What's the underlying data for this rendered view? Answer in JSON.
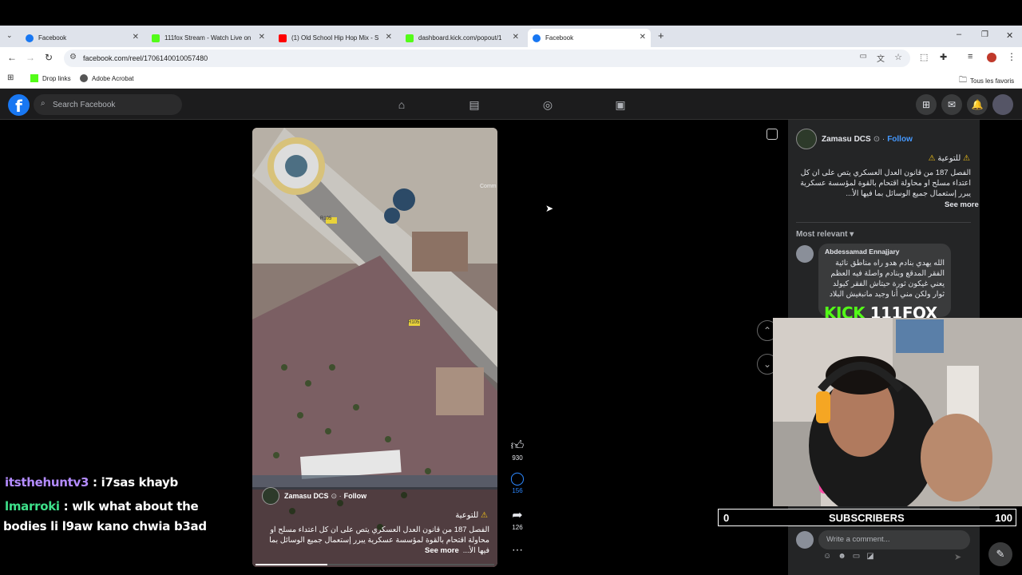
{
  "browser": {
    "tabs": [
      {
        "title": "Facebook",
        "color": "#1877f2",
        "active": false
      },
      {
        "title": "111fox Stream - Watch Live on",
        "color": "#53fc18",
        "active": false
      },
      {
        "title": "(1) Old School Hip Hop Mix - S",
        "color": "#ff0000",
        "active": false
      },
      {
        "title": "dashboard.kick.com/popout/1",
        "color": "#53fc18",
        "active": false
      },
      {
        "title": "Facebook",
        "color": "#1877f2",
        "active": true
      }
    ],
    "url": "facebook.com/reel/1706140010057480",
    "bookmarks": {
      "drop_links": "Drop links",
      "adobe": "Adobe Acrobat",
      "all_favorites": "Tous les favoris"
    }
  },
  "facebook": {
    "search_placeholder": "Search Facebook"
  },
  "reel": {
    "page_name": "Zamasu DCS",
    "follow": "Follow",
    "warning": "للتوعية",
    "caption": "الفصل 187 من قانون العدل العسكري يتص على ان كل اعتداء مسلح او محاولة اقتحام بالقوة لمؤسسة عسكرية يبرر إستعمال جميع الوسائل بما فيها الأ...",
    "see_more": "See more",
    "likes": "930",
    "comments": "156",
    "shares": "126",
    "map_labels": [
      "R105",
      "R105",
      "Comm"
    ],
    "progress": 0.3
  },
  "side_panel": {
    "page_name": "Zamasu DCS",
    "follow": "Follow",
    "warning": "للتوعية",
    "caption": "الفصل 187 من قانون العدل العسكري يتص على ان كل اعتداء مسلح او محاولة اقتحام بالقوة لمؤسسة عسكرية يبرر إستعمال جميع الوسائل بما فيها الأ...",
    "see_more": "See more",
    "sort": "Most relevant",
    "comment_author": "Abdessamad Ennajjary",
    "comment_text": "الله يهدي بنادم هدو راه مناطق نائية الفقر المدقع وبنادم واصلة فيه العظم يعني غيكون ثورة حيتاش الفقر كيولد ثوار ولكن مني أنا وجيد مانبغيش البلاد",
    "write_comment": "Write a comment..."
  },
  "stream_overlay": {
    "logo": "KICK 111FOX",
    "chat": [
      {
        "user": "itsthehuntv3",
        "user_color": "#b48cff",
        "message": "i7sas khayb"
      },
      {
        "user": "lmarroki",
        "user_color": "#3ee08a",
        "message": "wlk what about the"
      },
      {
        "user": "",
        "user_color": "#ffffff",
        "message": "bodies li l9aw kano chwia b3ad"
      }
    ],
    "subscribers": {
      "current": "0",
      "label": "SUBSCRIBERS",
      "goal": "100"
    }
  }
}
